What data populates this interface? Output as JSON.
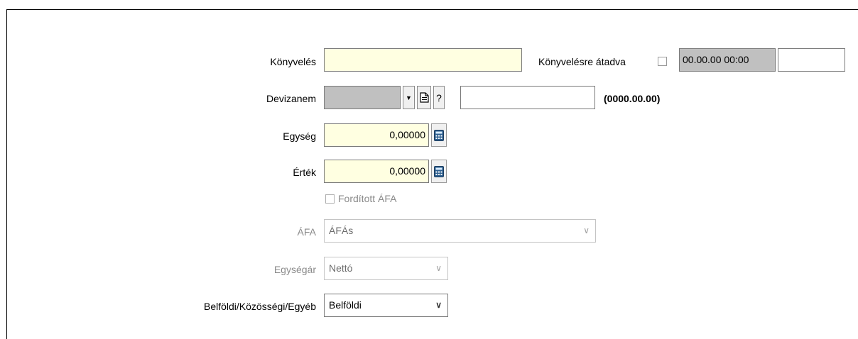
{
  "konyveles": {
    "label": "Könyvelés",
    "value": ""
  },
  "konyvelesre_atadva": {
    "label": "Könyvelésre átadva",
    "checked": false,
    "datetime": "00.00.00 00:00",
    "extra": ""
  },
  "devizanem": {
    "label": "Devizanem",
    "value": "",
    "doc_icon": "document-icon",
    "help_label": "?",
    "field": "",
    "date_text": "(0000.00.00)"
  },
  "egyseg": {
    "label": "Egység",
    "value": "0,00000",
    "icon": "calculator-icon"
  },
  "ertek": {
    "label": "Érték",
    "value": "0,00000",
    "icon": "calculator-icon"
  },
  "forditott_afa": {
    "label": "Fordított ÁFA",
    "checked": false
  },
  "afa": {
    "label": "ÁFA",
    "value": "ÁFÁs"
  },
  "egysegar": {
    "label": "Egységár",
    "value": "Nettó"
  },
  "belfoldi": {
    "label": "Belföldi/Közösségi/Egyéb",
    "value": "Belföldi"
  }
}
